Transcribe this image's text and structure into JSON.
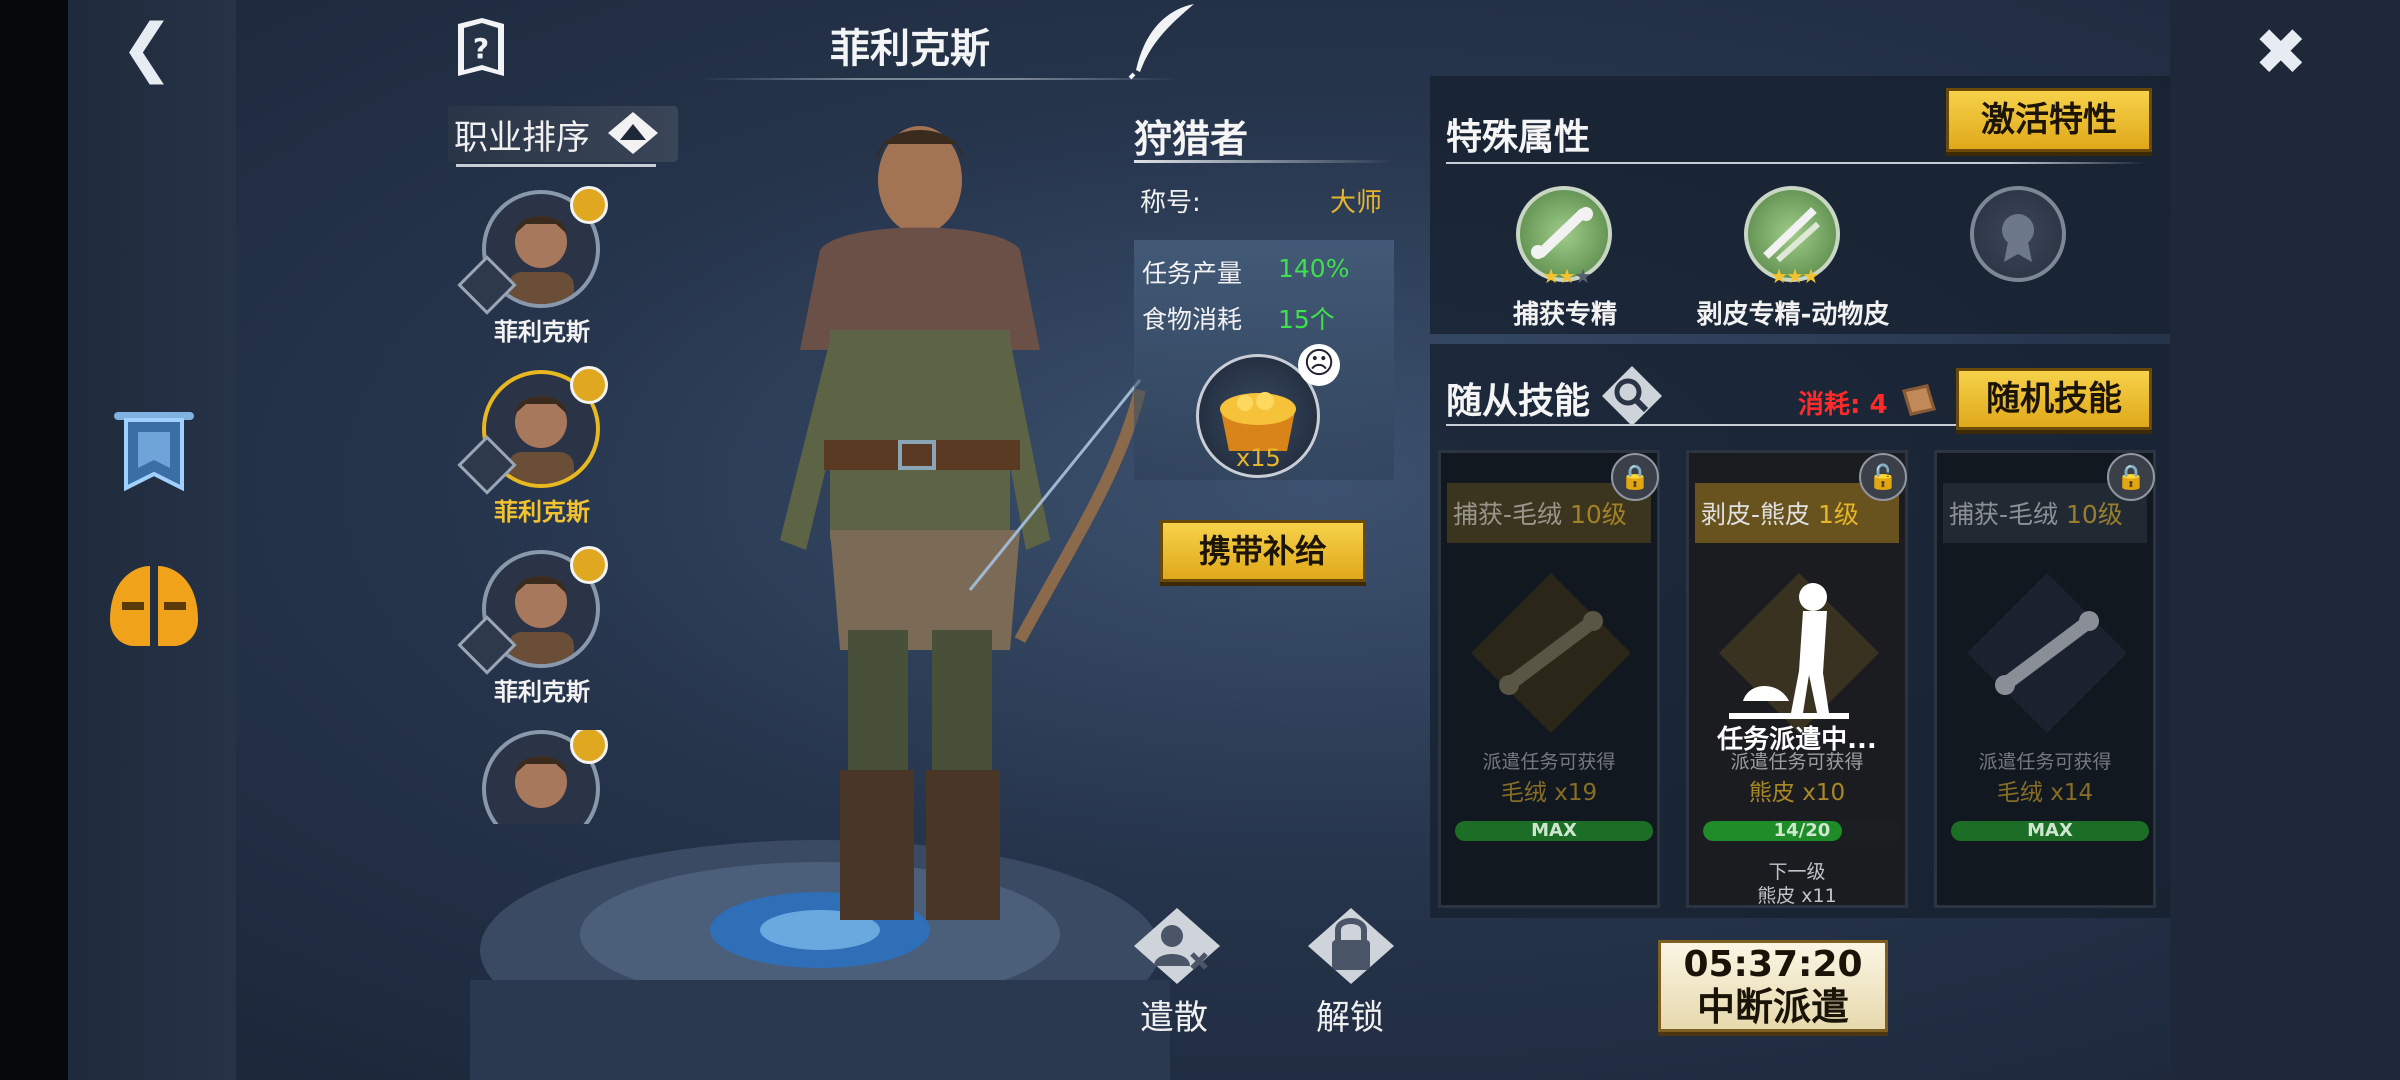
{
  "header": {
    "hero_name": "菲利克斯",
    "back_icon": "back-arrow-icon",
    "close_icon": "close-x-icon"
  },
  "sidebar": {
    "icons": [
      "banner-icon",
      "helmet-icon"
    ]
  },
  "roster": {
    "sort_label": "职业排序",
    "items": [
      {
        "name": "菲利克斯",
        "selected": false
      },
      {
        "name": "菲利克斯",
        "selected": true
      },
      {
        "name": "菲利克斯",
        "selected": false
      },
      {
        "name": "",
        "selected": false
      }
    ]
  },
  "profile": {
    "class_name": "狩猎者",
    "title_label": "称号:",
    "title_value": "大师",
    "stats": [
      {
        "label": "任务产量",
        "value": "140%"
      },
      {
        "label": "食物消耗",
        "value": "15个"
      }
    ],
    "supply_count": "x15",
    "supply_button": "携带补给",
    "dismiss_label": "遣散",
    "unlock_label": "解锁"
  },
  "special": {
    "title": "特殊属性",
    "activate_button": "激活特性",
    "traits": [
      {
        "label": "捕获专精",
        "stars": 2,
        "max_stars": 3,
        "locked": false
      },
      {
        "label": "剥皮专精-动物皮",
        "stars": 3,
        "max_stars": 3,
        "locked": false
      },
      {
        "label": "",
        "stars": 0,
        "max_stars": 0,
        "locked": true
      }
    ]
  },
  "follower": {
    "title": "随从技能",
    "cost_label": "消耗: 4",
    "random_button": "随机技能",
    "skills": [
      {
        "name": "捕获-毛绒",
        "level": "10级",
        "desc": "派遣任务可获得",
        "reward": "毛绒 x19",
        "bar_text": "MAX",
        "progress": 1.0,
        "active": false
      },
      {
        "name": "剥皮-熊皮",
        "level": "1级",
        "desc": "派遣任务可获得",
        "reward": "熊皮 x10",
        "bar_text": "14/20",
        "progress": 0.7,
        "active": true,
        "dispatch_text": "任务派遣中...",
        "next_label": "下一级",
        "next_value": "熊皮 x11"
      },
      {
        "name": "捕获-毛绒",
        "level": "10级",
        "desc": "派遣任务可获得",
        "reward": "毛绒 x14",
        "bar_text": "MAX",
        "progress": 1.0,
        "active": false
      }
    ]
  },
  "dispatch": {
    "timer": "05:37:20",
    "label": "中断派遣"
  },
  "colors": {
    "gold_button": "#f0c43a",
    "green_value": "#3ee04c",
    "cost_red": "#ff2a2a",
    "title_gold": "#e7b52a"
  }
}
